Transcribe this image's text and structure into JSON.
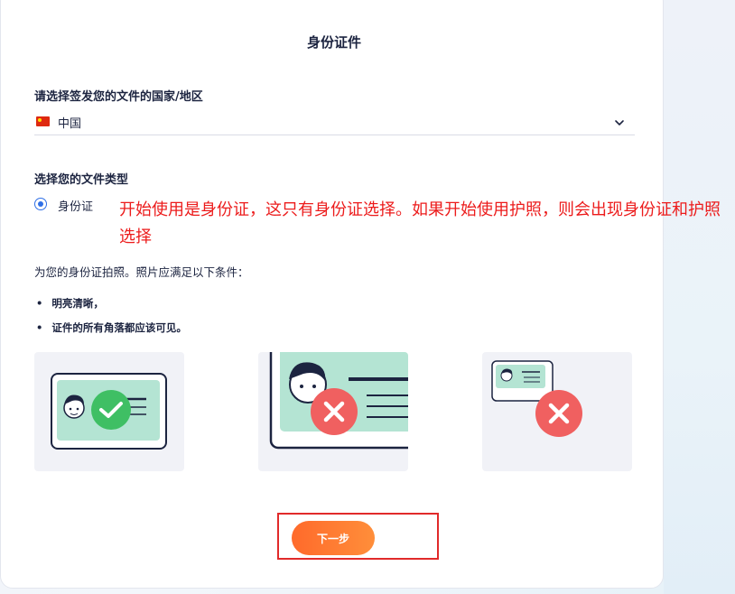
{
  "card": {
    "title": "身份证件"
  },
  "country_section": {
    "label": "请选择签发您的文件的国家/地区",
    "selected_country": "中国",
    "flag_icon": "china-flag-icon",
    "dropdown_icon": "chevron-down-icon"
  },
  "doc_type_section": {
    "label": "选择您的文件类型",
    "options": [
      {
        "label": "身份证",
        "selected": true
      }
    ]
  },
  "annotation": {
    "text": "开始使用是身份证，这只有身份证选择。如果开始使用护照，则会出现身份证和护照选择",
    "color": "#ec1b1b"
  },
  "instructions": {
    "text": "为您的身份证拍照。照片应满足以下条件：",
    "bullets": [
      "明亮清晰，",
      "证件的所有角落都应该可见。"
    ]
  },
  "examples": [
    {
      "name": "correct-example",
      "status_icon": "check-icon"
    },
    {
      "name": "too-close-example",
      "status_icon": "cross-icon"
    },
    {
      "name": "too-far-example",
      "status_icon": "cross-icon"
    }
  ],
  "next_button": {
    "label": "下一步"
  },
  "colors": {
    "accent_orange": "#ff7a30",
    "success_green": "#3fbf64",
    "error_red": "#f06060",
    "radio_blue": "#2f6fe6",
    "card_teal": "#b4e4d3"
  }
}
